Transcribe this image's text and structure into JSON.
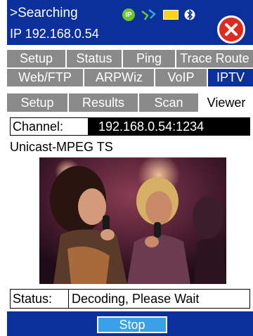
{
  "header": {
    "title": ">Searching",
    "ip": "IP 192.168.0.54"
  },
  "tabs_row1": [
    "Setup",
    "Status",
    "Ping",
    "Trace Route"
  ],
  "tabs_row2": [
    "Web/FTP",
    "ARPWiz",
    "VoIP",
    "IPTV"
  ],
  "subtabs": [
    "Setup",
    "Results",
    "Scan",
    "Viewer"
  ],
  "channel": {
    "label": "Channel:",
    "value": "192.168.0.54:1234"
  },
  "stream_type": "Unicast-MPEG TS",
  "status": {
    "label": "Status:",
    "value": "Decoding, Please Wait"
  },
  "footer": {
    "stop_label": "Stop"
  },
  "colors": {
    "header_bg": "#0b2f9b",
    "tab_bg": "#8a8a8a",
    "close_red": "#e02a1e",
    "stop_blue": "#3aa0e8"
  },
  "icons": [
    "ip-icon",
    "cable-icon",
    "battery-icon",
    "bluetooth-icon",
    "close-icon"
  ]
}
